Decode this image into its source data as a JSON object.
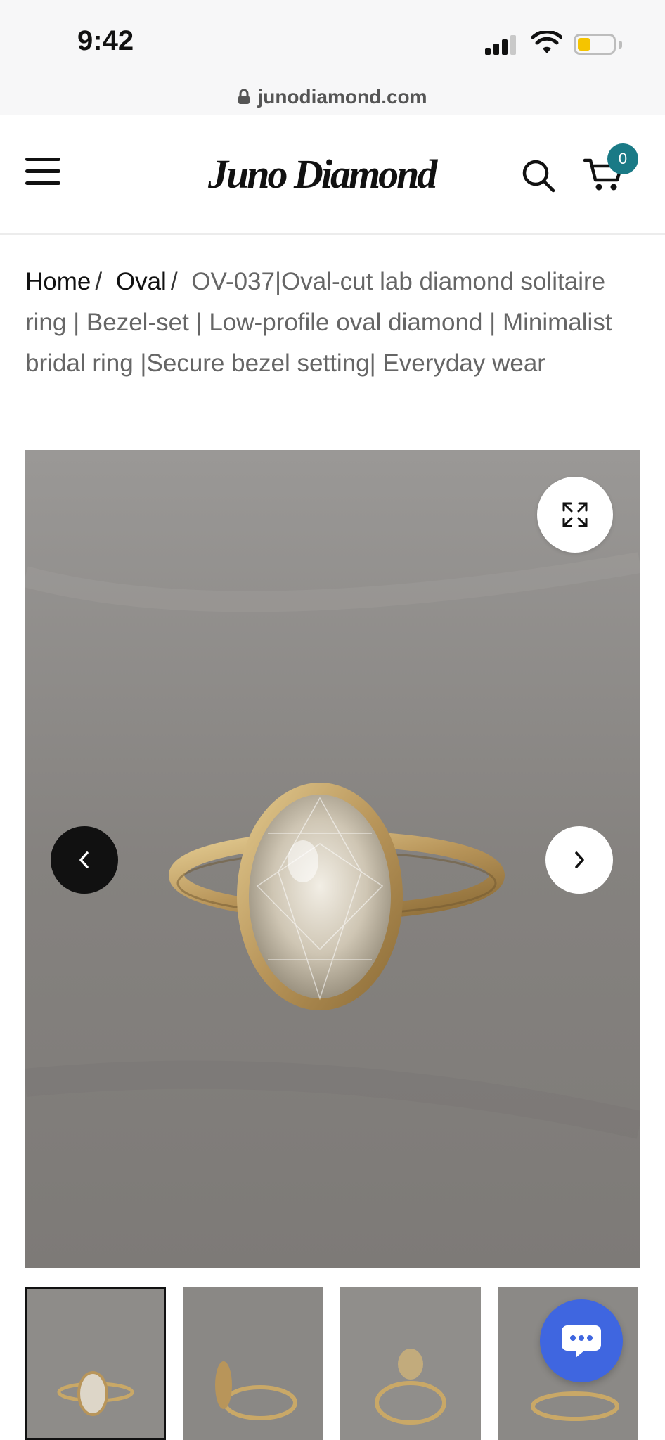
{
  "status_bar": {
    "time": "9:42"
  },
  "browser": {
    "url": "junodiamond.com"
  },
  "header": {
    "brand": "Juno Diamond",
    "cart_count": "0"
  },
  "breadcrumb": {
    "home": "Home",
    "separator": "/",
    "category": "Oval",
    "current": "OV-037|Oval-cut lab diamond solitaire ring | Bezel-set | Low-profile oval diamond | Minimalist bridal ring |Secure bezel setting| Everyday wear"
  },
  "gallery": {
    "icons": [
      "expand-icon",
      "chevron-left-icon",
      "chevron-right-icon",
      "chat-icon"
    ],
    "thumbnail_count": 4,
    "active_thumbnail": 1
  },
  "colors": {
    "accent_badge": "#1a7a86",
    "chat_button": "#3f66e0",
    "gold": "#c9a867"
  }
}
